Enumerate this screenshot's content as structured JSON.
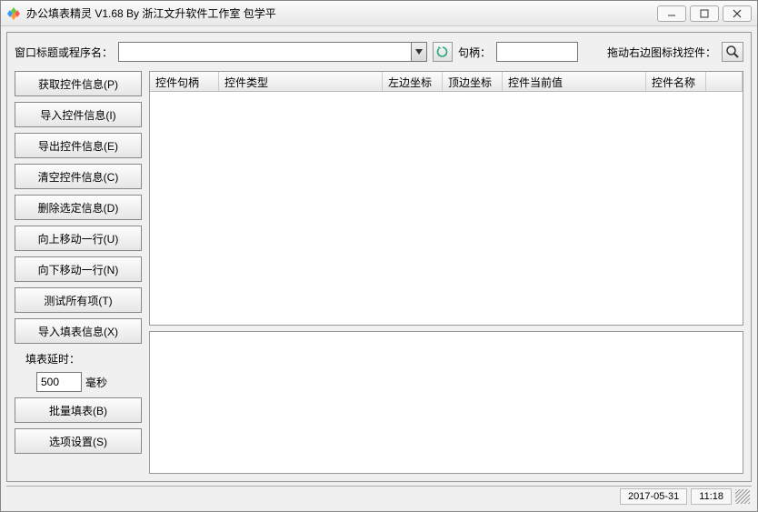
{
  "window": {
    "title": "办公填表精灵 V1.68 By 浙江文升软件工作室 包学平"
  },
  "toprow": {
    "label_window": "窗口标题或程序名：",
    "combo_value": "",
    "label_handle": "句柄：",
    "handle_value": "",
    "drag_hint": "拖动右边图标找控件："
  },
  "sidebar": {
    "btn_get": "获取控件信息(P)",
    "btn_import": "导入控件信息(I)",
    "btn_export": "导出控件信息(E)",
    "btn_clear": "清空控件信息(C)",
    "btn_delete": "删除选定信息(D)",
    "btn_moveup": "向上移动一行(U)",
    "btn_movedown": "向下移动一行(N)",
    "btn_testall": "测试所有项(T)",
    "btn_importfill": "导入填表信息(X)",
    "delay_label": "填表延时：",
    "delay_value": "500",
    "delay_unit": "毫秒",
    "btn_batchfill": "批量填表(B)",
    "btn_options": "选项设置(S)"
  },
  "columns": {
    "c1": "控件句柄",
    "c2": "控件类型",
    "c3": "左边坐标",
    "c4": "顶边坐标",
    "c5": "控件当前值",
    "c6": "控件名称"
  },
  "status": {
    "date": "2017-05-31",
    "time": "11:18"
  }
}
